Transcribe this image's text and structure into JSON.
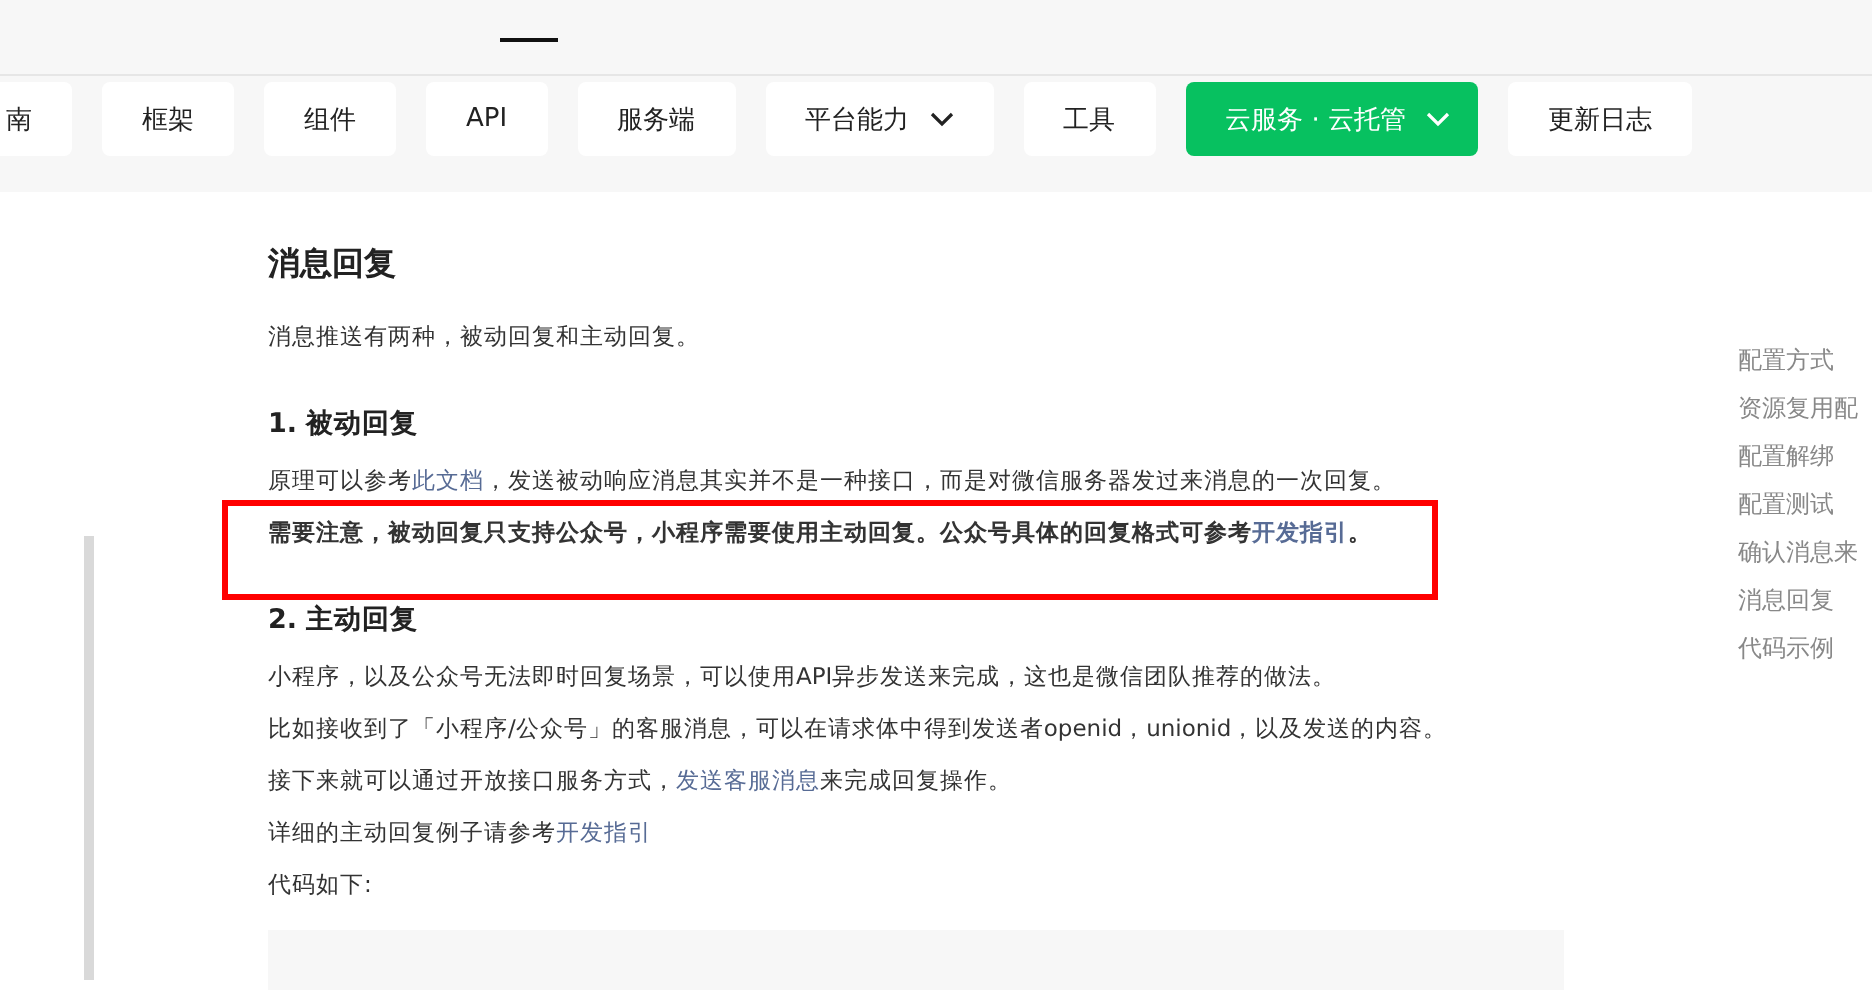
{
  "nav": [
    {
      "label": "南",
      "dropdown": false,
      "selected": false
    },
    {
      "label": "框架",
      "dropdown": false,
      "selected": false
    },
    {
      "label": "组件",
      "dropdown": false,
      "selected": false
    },
    {
      "label": "API",
      "dropdown": false,
      "selected": false
    },
    {
      "label": "服务端",
      "dropdown": false,
      "selected": false
    },
    {
      "label": "平台能力",
      "dropdown": true,
      "selected": false
    },
    {
      "label": "工具",
      "dropdown": false,
      "selected": false
    },
    {
      "label": "云服务 · 云托管",
      "dropdown": true,
      "selected": true
    },
    {
      "label": "更新日志",
      "dropdown": false,
      "selected": false
    }
  ],
  "article": {
    "title": "消息回复",
    "intro": "消息推送有两种，被动回复和主动回复。",
    "sections": [
      {
        "heading": "1. 被动回复",
        "paragraphs": [
          {
            "kind": "plain",
            "before": "原理可以参考",
            "link": "此文档",
            "after": "，发送被动响应消息其实并不是一种接口，而是对微信服务器发过来消息的一次回复。"
          },
          {
            "kind": "bold",
            "before": "需要注意，被动回复只支持公众号，小程序需要使用主动回复。公众号具体的回复格式可参考",
            "link": "开发指引",
            "after": "。"
          }
        ]
      },
      {
        "heading": "2. 主动回复",
        "paragraphs": [
          {
            "kind": "plain",
            "before": "小程序，以及公众号无法即时回复场景，可以使用API异步发送来完成，这也是微信团队推荐的做法。"
          },
          {
            "kind": "plain",
            "before": "比如接收到了「小程序/公众号」的客服消息，可以在请求体中得到发送者openid，unionid，以及发送的内容。"
          },
          {
            "kind": "plain",
            "before": "接下来就可以通过开放接口服务方式，",
            "link": "发送客服消息",
            "after": "来完成回复操作。"
          },
          {
            "kind": "plain",
            "before": "详细的主动回复例子请参考",
            "link": "开发指引"
          },
          {
            "kind": "plain",
            "before": "代码如下:"
          }
        ]
      }
    ]
  },
  "toc": [
    "配置方式",
    "资源复用配",
    "配置解绑",
    "配置测试",
    "确认消息来",
    "消息回复",
    "代码示例"
  ]
}
